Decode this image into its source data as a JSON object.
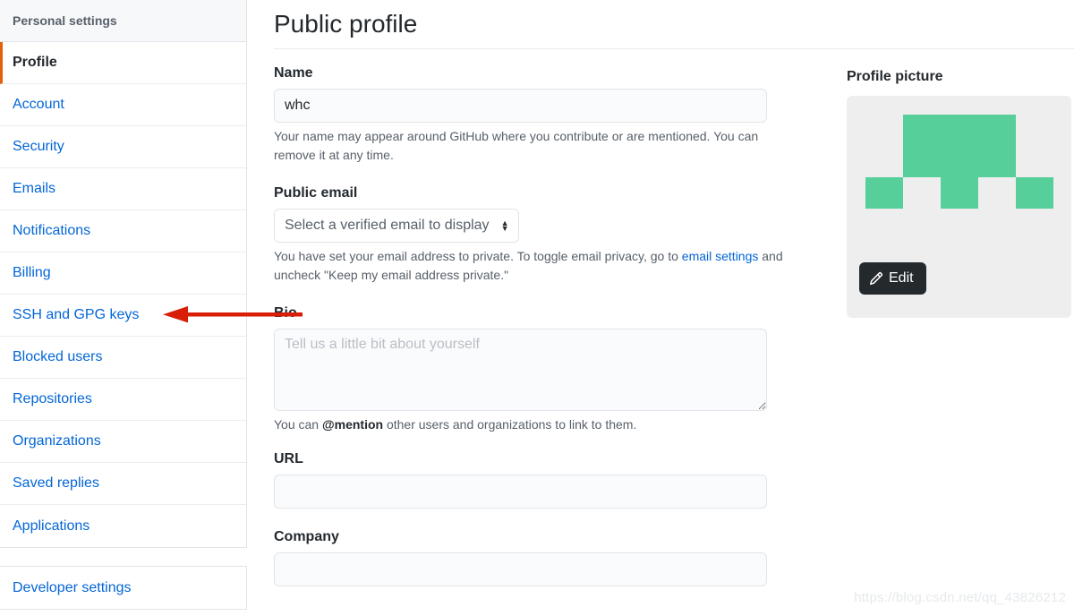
{
  "sidebar": {
    "header": "Personal settings",
    "selected_accent_color": "#e36209",
    "link_color": "#0366d6",
    "items": [
      {
        "label": "Profile",
        "selected": true
      },
      {
        "label": "Account",
        "selected": false
      },
      {
        "label": "Security",
        "selected": false
      },
      {
        "label": "Emails",
        "selected": false
      },
      {
        "label": "Notifications",
        "selected": false
      },
      {
        "label": "Billing",
        "selected": false
      },
      {
        "label": "SSH and GPG keys",
        "selected": false
      },
      {
        "label": "Blocked users",
        "selected": false
      },
      {
        "label": "Repositories",
        "selected": false
      },
      {
        "label": "Organizations",
        "selected": false
      },
      {
        "label": "Saved replies",
        "selected": false
      },
      {
        "label": "Applications",
        "selected": false
      }
    ],
    "footer_item": "Developer settings"
  },
  "main": {
    "title": "Public profile",
    "name": {
      "label": "Name",
      "value": "whc",
      "placeholder": "",
      "note_prefix": "Your name may appear around GitHub where you contribute or are mentioned. You can remove it at any time."
    },
    "public_email": {
      "label": "Public email",
      "selected_option": "Select a verified email to display",
      "options": [
        "Select a verified email to display"
      ],
      "note_before_link": "You have set your email address to private. To toggle email privacy, go to ",
      "note_link": "email settings",
      "note_after_link": " and uncheck \"Keep my email address private.\""
    },
    "bio": {
      "label": "Bio",
      "value": "",
      "placeholder": "Tell us a little bit about yourself",
      "note_before_mention": "You can ",
      "note_mention": "@mention",
      "note_after_mention": " other users and organizations to link to them."
    },
    "url": {
      "label": "URL",
      "value": "",
      "placeholder": ""
    },
    "company": {
      "label": "Company",
      "value": "",
      "placeholder": ""
    }
  },
  "avatar": {
    "heading": "Profile picture",
    "edit_label": "Edit",
    "identicon_color": "#56cf9a",
    "identicon_background": "#eeeeee",
    "identicon_grid": [
      [
        0,
        1,
        1,
        1,
        0
      ],
      [
        0,
        1,
        1,
        1,
        0
      ],
      [
        1,
        0,
        1,
        0,
        1
      ],
      [
        0,
        0,
        0,
        0,
        0
      ],
      [
        0,
        0,
        0,
        0,
        0
      ]
    ]
  },
  "annotation": {
    "arrow_color": "#d81e06",
    "arrow_direction": "left",
    "points_at": "SSH and GPG keys"
  },
  "watermark": {
    "text": "https://blog.csdn.net/qq_43826212"
  }
}
